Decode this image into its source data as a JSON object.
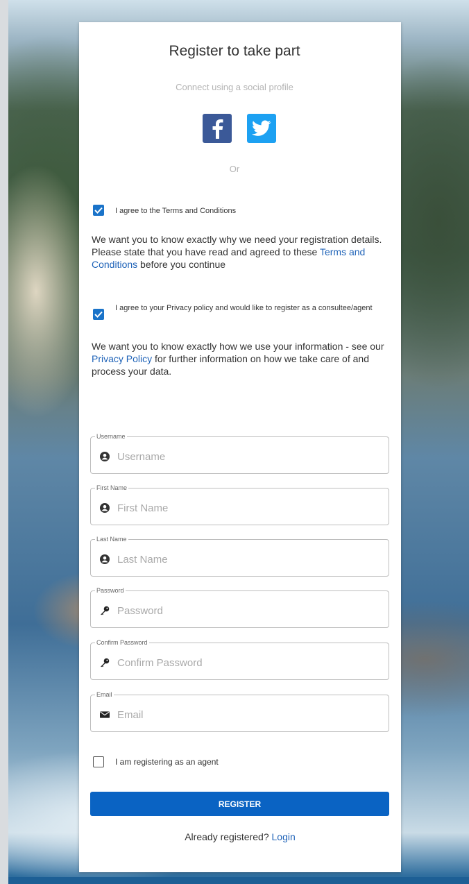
{
  "form": {
    "title": "Register to take part",
    "social_prompt": "Connect using a social profile",
    "social_buttons": [
      {
        "name": "facebook",
        "icon": "facebook-icon",
        "color": "#3b5998"
      },
      {
        "name": "twitter",
        "icon": "twitter-icon",
        "color": "#1da1f2"
      }
    ],
    "or_label": "Or",
    "terms": {
      "checked": true,
      "label": "I agree to the Terms and Conditions",
      "info_before": "We want you to know exactly why we need your registration details. Please state that you have read and agreed to these ",
      "info_link": "Terms and Conditions",
      "info_after": " before you continue"
    },
    "privacy": {
      "checked": true,
      "label": "I agree to your Privacy policy and would like to register as a consultee/agent",
      "info_before": "We want you to know exactly how we use your information - see our ",
      "info_link": "Privacy Policy",
      "info_after": " for further information on how we take care of and process your data."
    },
    "fields": [
      {
        "key": "username",
        "legend": "Username",
        "placeholder": "Username",
        "value": "",
        "icon": "user-icon"
      },
      {
        "key": "first_name",
        "legend": "First Name",
        "placeholder": "First Name",
        "value": "",
        "icon": "user-icon"
      },
      {
        "key": "last_name",
        "legend": "Last Name",
        "placeholder": "Last Name",
        "value": "",
        "icon": "user-icon"
      },
      {
        "key": "password",
        "legend": "Password",
        "placeholder": "Password",
        "value": "",
        "icon": "key-icon"
      },
      {
        "key": "confirm_password",
        "legend": "Confirm Password",
        "placeholder": "Confirm Password",
        "value": "",
        "icon": "key-icon"
      },
      {
        "key": "email",
        "legend": "Email",
        "placeholder": "Email",
        "value": "",
        "icon": "envelope-icon"
      }
    ],
    "agent": {
      "checked": false,
      "label": "I am registering as an agent"
    },
    "register_label": "REGISTER",
    "login_prompt": "Already registered?",
    "login_link": "Login",
    "accent_color": "#0a63c3",
    "link_color": "#1f63b8"
  }
}
